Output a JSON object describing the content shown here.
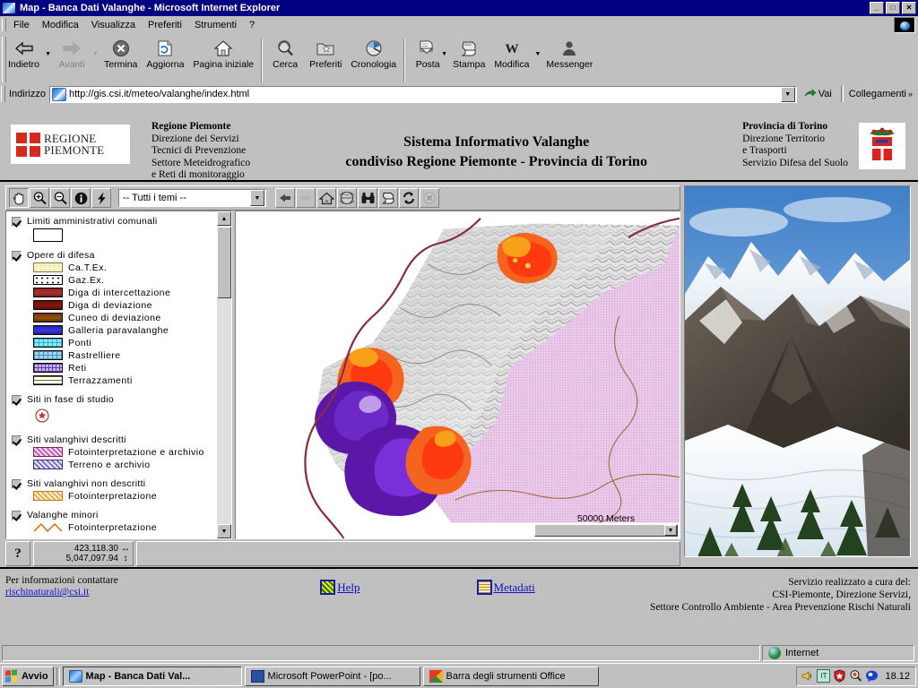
{
  "window": {
    "title": "Map - Banca Dati Valanghe - Microsoft Internet Explorer",
    "minimize_label": "_",
    "maximize_label": "□",
    "close_label": "✕"
  },
  "menu": {
    "items": [
      {
        "label": "File"
      },
      {
        "label": "Modifica"
      },
      {
        "label": "Visualizza"
      },
      {
        "label": "Preferiti"
      },
      {
        "label": "Strumenti"
      },
      {
        "label": "?"
      }
    ]
  },
  "toolbar": {
    "buttons": [
      {
        "label": "Indietro",
        "icon": "back-arrow-icon",
        "disabled": false
      },
      {
        "label": "Avanti",
        "icon": "forward-arrow-icon",
        "disabled": true
      },
      {
        "label": "Termina",
        "icon": "stop-icon",
        "disabled": false
      },
      {
        "label": "Aggiorna",
        "icon": "refresh-icon",
        "disabled": false
      },
      {
        "label": "Pagina iniziale",
        "icon": "home-icon",
        "disabled": false
      },
      {
        "label": "Cerca",
        "icon": "search-icon",
        "disabled": false
      },
      {
        "label": "Preferiti",
        "icon": "favorites-icon",
        "disabled": false
      },
      {
        "label": "Cronologia",
        "icon": "history-icon",
        "disabled": false
      },
      {
        "label": "Posta",
        "icon": "mail-icon",
        "disabled": false
      },
      {
        "label": "Stampa",
        "icon": "print-icon",
        "disabled": false
      },
      {
        "label": "Modifica",
        "icon": "word-edit-icon",
        "disabled": false
      },
      {
        "label": "Messenger",
        "icon": "messenger-person-icon",
        "disabled": false
      }
    ]
  },
  "address": {
    "label": "Indirizzo",
    "url": "http://gis.csi.it/meteo/valanghe/index.html",
    "go_label": "Vai",
    "links_label": "Collegamenti"
  },
  "banner": {
    "logo_text_line1": "REGIONE",
    "logo_text_line2": "PIEMONTE",
    "left": {
      "line1": "Regione Piemonte",
      "line2": "Direzione dei Servizi",
      "line3": "Tecnici di Prevenzione",
      "line4": "Settore Meteidrografico",
      "line5": "e Reti di monitoraggio"
    },
    "center": {
      "line1": "Sistema Informativo Valanghe",
      "line2": "condiviso Regione Piemonte - Provincia di Torino"
    },
    "right": {
      "line1": "Provincia di Torino",
      "line2": "Direzione Territorio",
      "line3": "e Trasporti",
      "line4": "Servizio Difesa del Suolo"
    }
  },
  "gis": {
    "tools_left": [
      {
        "icon": "pan-hand-icon",
        "pressed": true
      },
      {
        "icon": "zoom-in-icon",
        "pressed": false
      },
      {
        "icon": "zoom-out-icon",
        "pressed": false
      },
      {
        "icon": "identify-info-icon",
        "pressed": false
      },
      {
        "icon": "lightning-query-icon",
        "pressed": false
      }
    ],
    "theme_select": {
      "value": "-- Tutti i temi --",
      "options": [
        "-- Tutti i temi --"
      ]
    },
    "tools_right": [
      {
        "icon": "previous-extent-icon",
        "disabled": false
      },
      {
        "icon": "next-extent-icon",
        "disabled": true
      },
      {
        "icon": "full-extent-home-icon",
        "disabled": false
      },
      {
        "icon": "globe-overview-icon",
        "disabled": false
      },
      {
        "icon": "find-binoculars-icon",
        "disabled": false
      },
      {
        "icon": "print-map-icon",
        "disabled": false
      },
      {
        "icon": "refresh-map-icon",
        "disabled": false
      },
      {
        "icon": "clear-selection-icon",
        "disabled": true
      }
    ],
    "legend": [
      {
        "title": "Limiti amministrativi comunali",
        "checked": true,
        "big_swatch": {
          "fill": "#ffffff",
          "stroke": "#000000"
        },
        "items": []
      },
      {
        "title": "Opere di difesa",
        "checked": true,
        "items": [
          {
            "label": "Ca.T.Ex.",
            "fill": "#fdf3c0",
            "pattern": "dots-sparse"
          },
          {
            "label": "Gaz.Ex.",
            "fill": "#ffffff",
            "pattern": "dots-dense"
          },
          {
            "label": "Diga di intercettazione",
            "fill": "#a02a2a",
            "pattern": "solid"
          },
          {
            "label": "Diga di deviazione",
            "fill": "#7e1010",
            "pattern": "solid"
          },
          {
            "label": "Cuneo di deviazione",
            "fill": "#8a4a08",
            "pattern": "solid"
          },
          {
            "label": "Galleria paravalanghe",
            "fill": "#2a28c8",
            "pattern": "solid"
          },
          {
            "label": "Ponti",
            "fill": "#7ff0ff",
            "pattern": "grid"
          },
          {
            "label": "Rastrelliere",
            "fill": "#9ad8f5",
            "pattern": "grid"
          },
          {
            "label": "Reti",
            "fill": "#c9b4f0",
            "pattern": "grid"
          },
          {
            "label": "Terrazzamenti",
            "fill": "#ffffff",
            "pattern": "lines-h"
          }
        ]
      },
      {
        "title": "Siti in fase di studio",
        "checked": true,
        "point_symbol": {
          "label": "",
          "color": "#b03030"
        },
        "items": []
      },
      {
        "title": "Siti valanghivi descritti",
        "checked": true,
        "items": [
          {
            "label": "Fotointerpretazione e archivio",
            "fill": "#f0c8e8",
            "pattern": "hatch"
          },
          {
            "label": "Terreno e archivio",
            "fill": "#d8d4f2",
            "pattern": "hatch"
          }
        ]
      },
      {
        "title": "Siti valanghivi non descritti",
        "checked": true,
        "items": [
          {
            "label": "Fotointerpretazione",
            "fill": "#fde8c0",
            "pattern": "hatch-orange"
          }
        ]
      },
      {
        "title": "Valanghe minori",
        "checked": true,
        "items": [
          {
            "label": "Fotointerpretazione",
            "fill": "#ffffff",
            "pattern": "zigzag-orange"
          }
        ]
      }
    ],
    "scale": {
      "label": "50000 Meters"
    },
    "status": {
      "help_label": "?",
      "coord_x": "423,118.30",
      "coord_y": "5,047,097.94",
      "x_glyph": "↔",
      "y_glyph": "↕"
    }
  },
  "footer": {
    "contact_text": "Per informazioni contattare",
    "contact_email": "rischinaturali@csi.it",
    "help_label": "Help",
    "metadata_label": "Metadati",
    "credits_line1": "Servizio realizzato a cura del:",
    "credits_line2": "CSI-Piemonte, Direzione Servizi,",
    "credits_line3": "Settore Controllo Ambiente - Area Prevenzione Rischi Naturali"
  },
  "status_bar": {
    "zone_label": "Internet"
  },
  "taskbar": {
    "start_label": "Avvio",
    "items": [
      {
        "label": "Map - Banca Dati Val...",
        "icon": "ie-icon",
        "active": true
      },
      {
        "label": "Microsoft PowerPoint - [po...",
        "icon": "powerpoint-icon",
        "active": false
      },
      {
        "label": "Barra degli strumenti Office",
        "icon": "office-icon",
        "active": false
      }
    ],
    "tray_icons": [
      "volume-icon",
      "keyboard-layout-icon",
      "antivirus-shield-icon",
      "findfast-icon",
      "messenger-icon"
    ],
    "clock": "18.12"
  },
  "colors": {
    "titlebar": "#000080",
    "chrome": "#c0c0c0",
    "link": "#1111cc",
    "map_pink": "#e0a8dd",
    "map_orange": "#f4641e",
    "map_purple": "#5b18a8"
  }
}
